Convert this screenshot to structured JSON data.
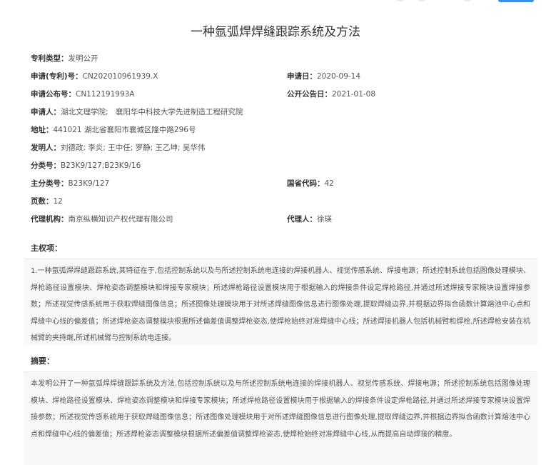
{
  "title": "一种氩弧焊焊缝跟踪系统及方法",
  "fields": {
    "patent_type": {
      "label": "专利类型：",
      "value": "发明公开"
    },
    "app_no": {
      "label": "申请(专利)号：",
      "value": "CN202010961939.X"
    },
    "app_date": {
      "label": "申请日：",
      "value": "2020-09-14"
    },
    "pub_no": {
      "label": "申请公布号：",
      "value": "CN112191993A"
    },
    "pub_date": {
      "label": "公开公告日：",
      "value": "2021-01-08"
    },
    "applicant": {
      "label": "申请人：",
      "value": "湖北文理学院;　襄阳华中科技大学先进制造工程研究院"
    },
    "address": {
      "label": "地址：",
      "value": "441021 湖北省襄阳市襄城区隆中路296号"
    },
    "inventors": {
      "label": "发明人：",
      "value": "刘德政; 李炎; 王中任; 罗静; 王乙坤; 吴华伟"
    },
    "class_no": {
      "label": "分类号：",
      "value": "B23K9/127;B23K9/16"
    },
    "main_class": {
      "label": "主分类号：",
      "value": "B23K9/127"
    },
    "province_code": {
      "label": "国省代码：",
      "value": "42"
    },
    "pages": {
      "label": "页数：",
      "value": "12"
    },
    "agency": {
      "label": "代理机构：",
      "value": "南京纵横知识产权代理有限公司"
    },
    "agent": {
      "label": "代理人：",
      "value": "徐瑛"
    }
  },
  "claims": {
    "heading": "主权项：",
    "text": "1.一种氩弧焊焊缝跟踪系统,其特征在于,包括控制系统以及与所述控制系统电连接的焊接机器人、视觉传感系统、焊接电源；所述控制系统包括图像处理模块、焊枪路径设置模块、焊枪姿态调整模块和焊接专家模块；所述焊枪路径设置模块用于根据输入的焊接条件设定焊枪路径,并通过所述焊接专家模块设置焊接参数；所述视觉传感系统用于获取焊缝图像信息；所述图像处理模块用于对所述焊缝图像信息进行图像处理,提取焊缝边界,并根据边界拟合函数计算熔池中心点和焊缝中心线的偏差值；所述焊枪姿态调整模块根据所述偏差值调整焊枪姿态,使焊枪始终对准焊缝中心线；所述焊接机器人包括机械臂和焊枪,所述焊枪安装在机械臂的夹持端,所述机械臂与控制系统电连接。"
  },
  "abstract": {
    "heading": "摘要：",
    "text": "本发明公开了一种氩弧焊焊缝跟踪系统及方法,包括控制系统以及与所述控制系统电连接的焊接机器人、视觉传感系统、焊接电源；所述控制系统包括图像处理模块、焊枪路径设置模块、焊枪姿态调整模块和焊接专家模块；所述焊枪路径设置模块用于根据输入的焊接条件设定焊枪路径,并通过所述焊接专家模块设置焊接参数；所述视觉传感系统用于获取焊缝图像信息；所述图像处理模块用于对所述焊缝图像信息进行图像处理,提取焊缝边界,并根据边界拟合函数计算熔池中心点和焊缝中心线的偏差值；所述焊枪姿态调整模块根据所述偏差值调整焊枪姿态,使焊枪始终对准焊缝中心线,从而提高自动焊接的精度。"
  }
}
